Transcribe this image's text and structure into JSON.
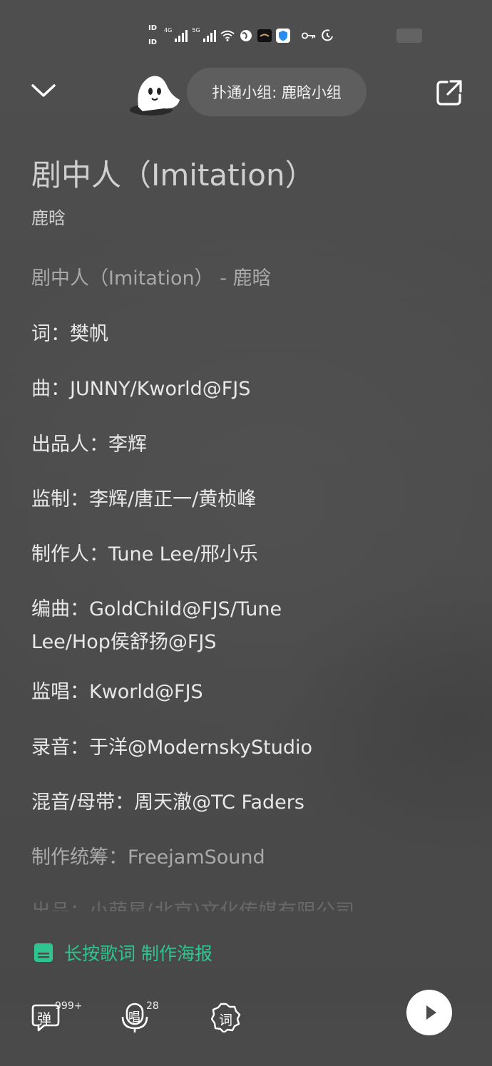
{
  "status_bar": {
    "sim1": "ID",
    "sim2": "ID",
    "net1": "4G",
    "net2": "5G",
    "icons": [
      "wifi-icon",
      "globe-icon",
      "app-icon",
      "shield-icon",
      "key-icon",
      "alarm-icon"
    ]
  },
  "header": {
    "group_label": "扑通小组: 鹿晗小组",
    "collapse_icon": "chevron-down-icon",
    "share_icon": "share-external-icon"
  },
  "song": {
    "title": "剧中人（Imitation）",
    "artist": "鹿晗"
  },
  "lyrics": [
    "剧中人（Imitation） - 鹿晗",
    "词：樊帆",
    "曲：JUNNY/Kworld@FJS",
    "出品人：李辉",
    "监制：李辉/唐正一/黄桢峰",
    "制作人：Tune Lee/邢小乐",
    "编曲：GoldChild@FJS/Tune Lee/Hop侯舒扬@FJS",
    "监唱：Kworld@FJS",
    "录音：于洋@ModernskyStudio",
    "混音/母带：周天澈@TC Faders",
    "制作统筹：FreejamSound",
    "出品：小萌星(北京)文化传媒有限公司"
  ],
  "poster_hint": "长按歌词 制作海报",
  "toolbar": {
    "danmaku_label": "弹",
    "danmaku_count": "999+",
    "sing_label": "唱",
    "sing_count": "28",
    "lyrics_label": "词"
  },
  "colors": {
    "accent": "#2ec590",
    "background": "#4c4c4c",
    "pill": "#5e5e5e"
  }
}
